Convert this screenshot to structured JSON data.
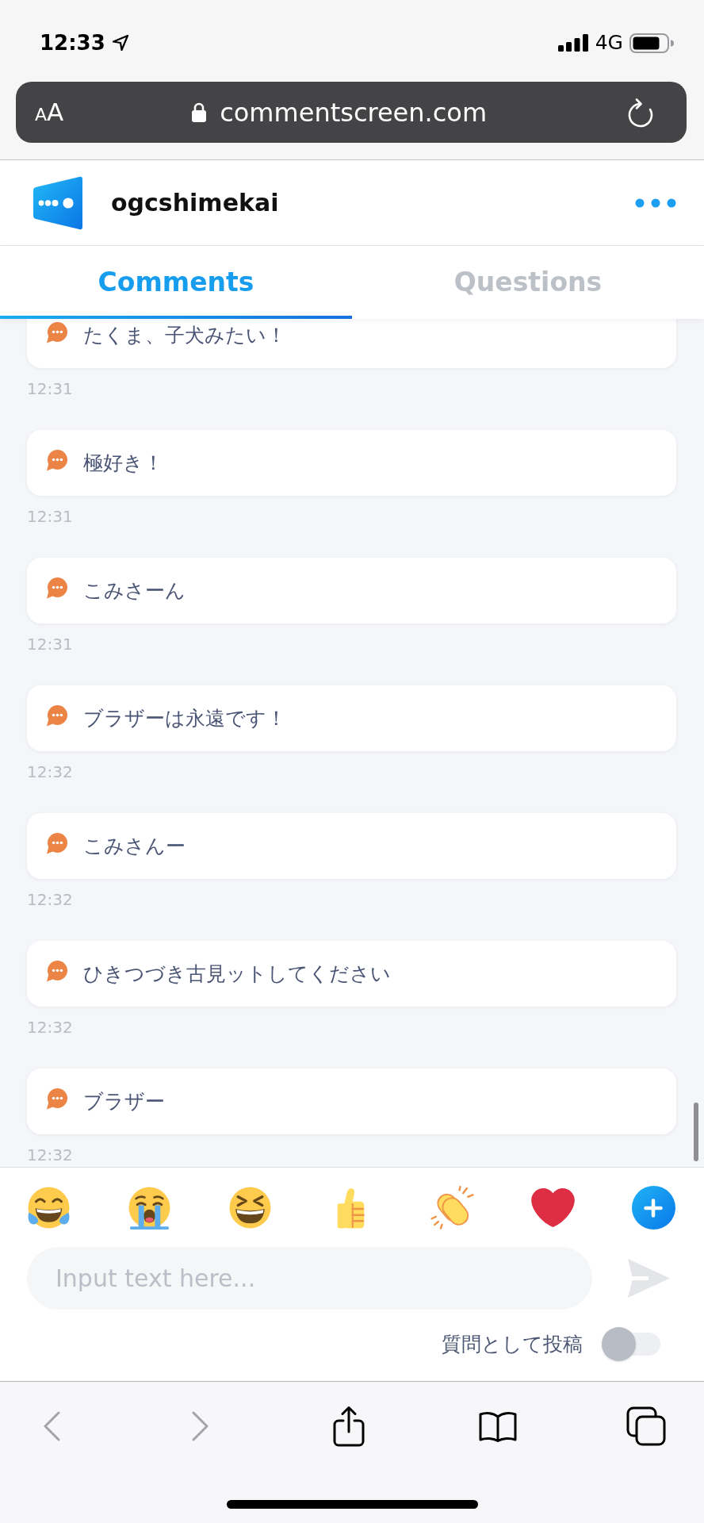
{
  "status_bar": {
    "time": "12:33",
    "network": "4G"
  },
  "address_bar": {
    "text_size_button": "AA",
    "url": "commentscreen.com"
  },
  "header": {
    "title": "ogcshimekai"
  },
  "tabs": [
    {
      "label": "Comments",
      "selected": true
    },
    {
      "label": "Questions",
      "selected": false
    }
  ],
  "comments": [
    {
      "text": "たくま、子犬みたい！",
      "time": "12:31"
    },
    {
      "text": "極好き！",
      "time": "12:31"
    },
    {
      "text": "こみさーん",
      "time": "12:31"
    },
    {
      "text": "ブラザーは永遠です！",
      "time": "12:32"
    },
    {
      "text": "こみさんー",
      "time": "12:32"
    },
    {
      "text": "ひきつづき古見ットしてください",
      "time": "12:32"
    },
    {
      "text": "ブラザー",
      "time": "12:32"
    }
  ],
  "reactions": [
    {
      "kind": "joy"
    },
    {
      "kind": "sob"
    },
    {
      "kind": "laughing"
    },
    {
      "kind": "thumbs-up"
    },
    {
      "kind": "clap"
    },
    {
      "kind": "heart"
    },
    {
      "kind": "add"
    }
  ],
  "composer": {
    "placeholder": "Input text here...",
    "post_as_question": {
      "label": "質問として投稿",
      "on": false
    }
  },
  "toolbar": [
    {
      "kind": "back",
      "disabled": true
    },
    {
      "kind": "forward",
      "disabled": true
    },
    {
      "kind": "share",
      "disabled": false
    },
    {
      "kind": "bookmarks",
      "disabled": false
    },
    {
      "kind": "tabs",
      "disabled": false
    }
  ]
}
